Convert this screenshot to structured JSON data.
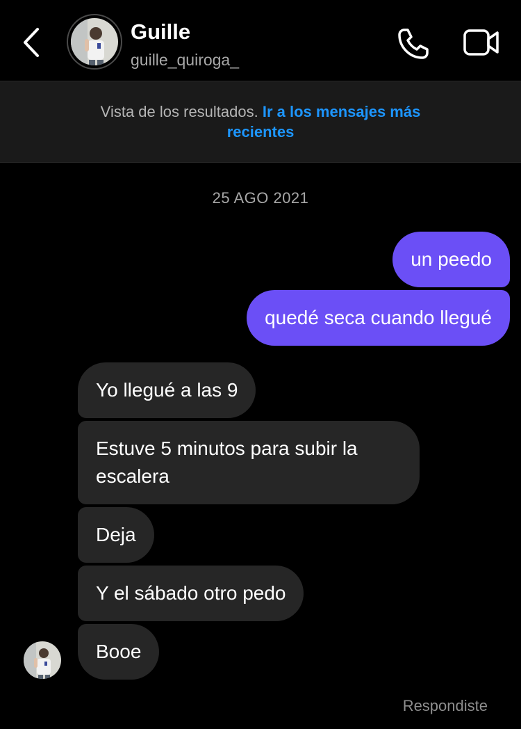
{
  "header": {
    "name": "Guille",
    "username": "guille_quiroga_",
    "icons": {
      "back": "chevron-left-icon",
      "call": "phone-icon",
      "video": "video-camera-icon"
    }
  },
  "banner": {
    "text": "Vista de los resultados.",
    "link": "Ir a los mensajes más recientes"
  },
  "conversation": {
    "date": "25 AGO 2021",
    "sent_messages": [
      "un peedo",
      "quedé seca cuando llegué"
    ],
    "received_messages": [
      "Yo llegué a las 9",
      "Estuve 5 minutos para subir la escalera",
      "Deja",
      "Y el sábado otro pedo",
      "Booe"
    ],
    "status": "Respondiste"
  },
  "colors": {
    "background": "#000000",
    "sent_bubble": "#6b4ff6",
    "received_bubble": "#262626",
    "link": "#1d96ff",
    "banner_bg": "#1a1a1a"
  }
}
